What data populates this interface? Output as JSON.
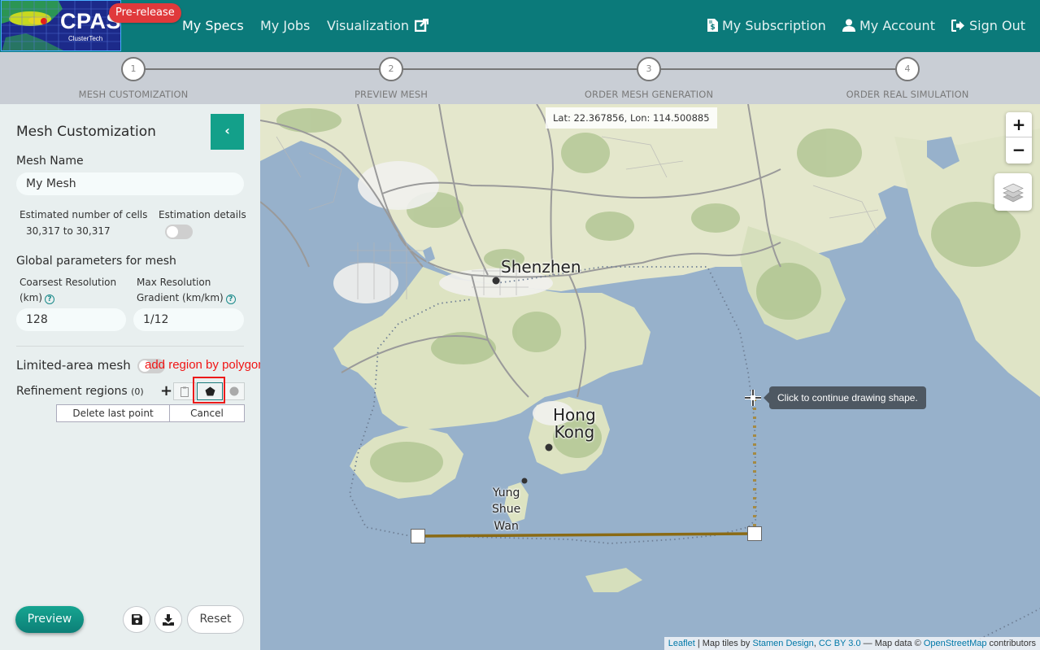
{
  "navbar": {
    "logo_title": "CPAS",
    "logo_subtitle": "ClusterTech",
    "badge": "Pre-release",
    "links": [
      {
        "label": "My Specs",
        "icon": null
      },
      {
        "label": "My Jobs",
        "icon": null
      },
      {
        "label": "Visualization",
        "icon": "external-link-icon"
      }
    ],
    "right_links": [
      {
        "label": "My Subscription",
        "icon": "invoice-icon"
      },
      {
        "label": "My Account",
        "icon": "user-icon"
      },
      {
        "label": "Sign Out",
        "icon": "sign-out-icon"
      }
    ]
  },
  "stepper": {
    "steps": [
      {
        "number": "1",
        "label": "MESH CUSTOMIZATION"
      },
      {
        "number": "2",
        "label": "PREVIEW MESH"
      },
      {
        "number": "3",
        "label": "ORDER MESH GENERATION"
      },
      {
        "number": "4",
        "label": "ORDER REAL SIMULATION"
      }
    ]
  },
  "sidebar": {
    "title": "Mesh Customization",
    "collapse_icon": "chevron-left-icon",
    "mesh_name_label": "Mesh Name",
    "mesh_name_value": "My Mesh",
    "estimated_cells_label": "Estimated number of cells",
    "estimated_cells_value": "30,317 to 30,317",
    "estimation_details_label": "Estimation details",
    "estimation_details_on": false,
    "global_params_label": "Global parameters for mesh",
    "coarsest_label_1": "Coarsest Resolution",
    "coarsest_label_2": "(km)",
    "coarsest_value": "128",
    "gradient_label_1": "Max Resolution",
    "gradient_label_2": "Gradient (km/km)",
    "gradient_value": "1/12",
    "limited_area_label": "Limited-area mesh",
    "limited_area_on": false,
    "annotation": "add region by polygon",
    "refinement_label": "Refinement regions",
    "refinement_count": "(0)",
    "tools": [
      "add-icon",
      "clipboard-icon",
      "polygon-icon",
      "circle-icon"
    ],
    "delete_last_point": "Delete last point",
    "cancel": "Cancel",
    "preview": "Preview",
    "reset": "Reset"
  },
  "map": {
    "coordinates": "Lat: 22.367856, Lon: 114.500885",
    "zoom_in": "+",
    "zoom_out": "−",
    "places": [
      "Shenzhen",
      "Hong Kong",
      "Yung Shue Wan"
    ],
    "place_lines": {
      "hong_kong": [
        "Hong",
        "Kong"
      ],
      "yung_shue_wan": [
        "Yung",
        "Shue",
        "Wan"
      ]
    },
    "tooltip": "Click to continue drawing shape.",
    "attribution": {
      "leaflet": "Leaflet",
      "sep1": " | Map tiles by ",
      "stamen": "Stamen Design",
      "comma": ", ",
      "cc": "CC BY 3.0",
      "mid": " — Map data © ",
      "osm": "OpenStreetMap",
      "end": " contributors"
    }
  },
  "colors": {
    "navbar": "#0b7a7a",
    "accent": "#13a08a",
    "badge": "#e0393b",
    "annotation": "#f01414",
    "drawing_line": "#8a6a14",
    "water": "#97b1cb",
    "land": "#e6e6c8"
  }
}
